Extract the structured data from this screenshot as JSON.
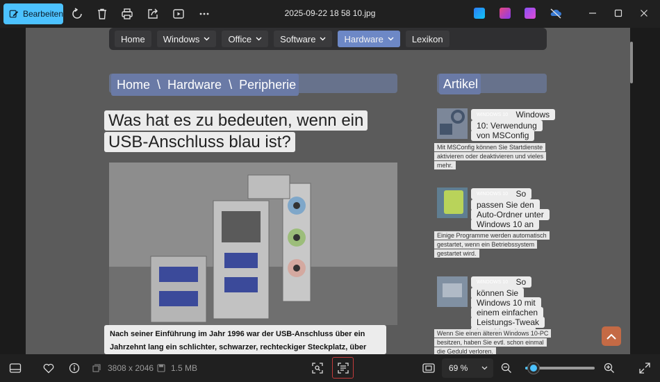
{
  "toolbar": {
    "edit_label": "Bearbeiten",
    "file_title": "2025-09-22 18 58 10.jpg"
  },
  "page": {
    "nav": [
      {
        "label": "Home",
        "dropdown": false,
        "active": false
      },
      {
        "label": "Windows",
        "dropdown": true,
        "active": false
      },
      {
        "label": "Office",
        "dropdown": true,
        "active": false
      },
      {
        "label": "Software",
        "dropdown": true,
        "active": false
      },
      {
        "label": "Hardware",
        "dropdown": true,
        "active": true
      },
      {
        "label": "Lexikon",
        "dropdown": false,
        "active": false
      }
    ],
    "breadcrumb": [
      "Home",
      "Hardware",
      "Peripherie"
    ],
    "breadcrumb_separator": "\\",
    "sidebar_heading": "Artikel",
    "headline": "Was hat es zu bedeuten, wenn ein USB-Anschluss blau ist?",
    "body_text": "Nach seiner Einführung im Jahr 1996 war der USB-Anschluss über ein Jahrzehnt lang ein schlichter, schwarzer, rechteckiger Steckplatz, über den Tastaturen und",
    "articles": [
      {
        "badge": "WINDOWS 10",
        "title": "Windows 10: Verwendung von MSConfig",
        "desc": "Mit MSConfig können Sie Startdienste aktivieren oder deaktivieren und vieles mehr."
      },
      {
        "badge": "WINDOWS 10",
        "title": "So passen Sie den Auto-Ordner unter Windows 10 an",
        "desc": "Einige Programme werden automatisch gestartet, wenn ein Betriebssystem gestartet wird."
      },
      {
        "badge": "WINDOWS 10",
        "title": "So können Sie Windows 10 mit einem einfachen Leistungs-Tweak beschleunigen",
        "desc": "Wenn Sie einen älteren Windows 10-PC besitzen, haben Sie evtl. schon einmal die Geduld verloren."
      }
    ]
  },
  "statusbar": {
    "dimensions": "3808 x 2046",
    "file_size": "1.5 MB",
    "zoom_label": "69 %",
    "zoom_fraction": 0.12
  },
  "colors": {
    "accent": "#4cc2ff",
    "nav_active": "#6d88c6",
    "badge": "#2c3b8f",
    "scroll_top_button": "#c46a45"
  }
}
